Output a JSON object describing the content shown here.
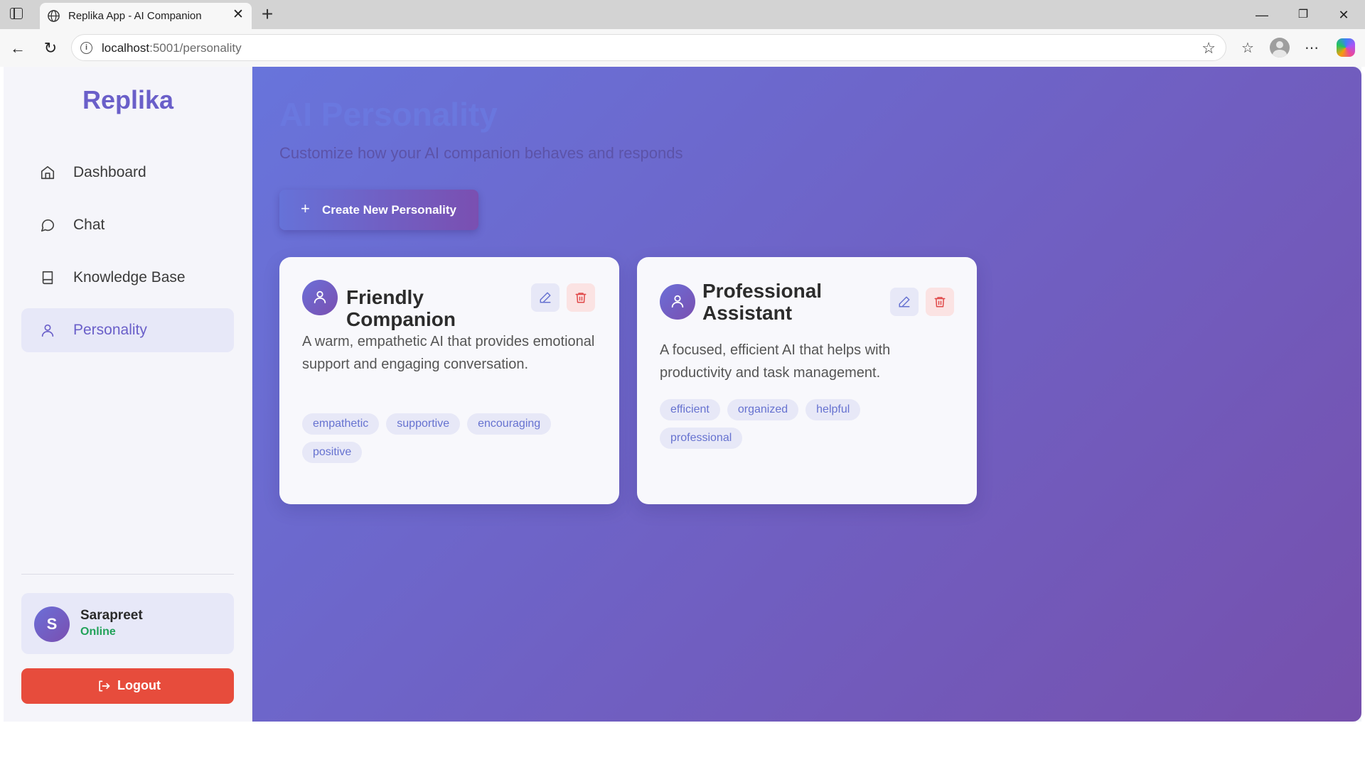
{
  "browser": {
    "tab_title": "Replika App - AI Companion",
    "url_host": "localhost",
    "url_path": ":5001/personality"
  },
  "sidebar": {
    "brand": "Replika",
    "items": [
      {
        "label": "Dashboard",
        "icon": "home-icon",
        "active": false
      },
      {
        "label": "Chat",
        "icon": "message-circle-icon",
        "active": false
      },
      {
        "label": "Knowledge Base",
        "icon": "book-icon",
        "active": false
      },
      {
        "label": "Personality",
        "icon": "user-icon",
        "active": true
      }
    ],
    "user": {
      "initial": "S",
      "name": "Sarapreet",
      "status": "Online"
    },
    "logout_label": "Logout"
  },
  "main": {
    "title": "AI Personality",
    "subtitle": "Customize how your AI companion behaves and responds",
    "create_label": "Create New Personality",
    "cards": [
      {
        "name": "Friendly Companion",
        "description": "A warm, empathetic AI that provides emotional support and engaging conversation.",
        "traits": [
          "empathetic",
          "supportive",
          "encouraging",
          "positive"
        ]
      },
      {
        "name": "Professional Assistant",
        "description": "A focused, efficient AI that helps with productivity and task management.",
        "traits": [
          "efficient",
          "organized",
          "helpful",
          "professional"
        ]
      }
    ]
  },
  "colors": {
    "accent": "#6a5fc9",
    "danger": "#e74c3c",
    "online": "#22a25a",
    "gradient_start": "#6874db",
    "gradient_end": "#7650ad"
  }
}
